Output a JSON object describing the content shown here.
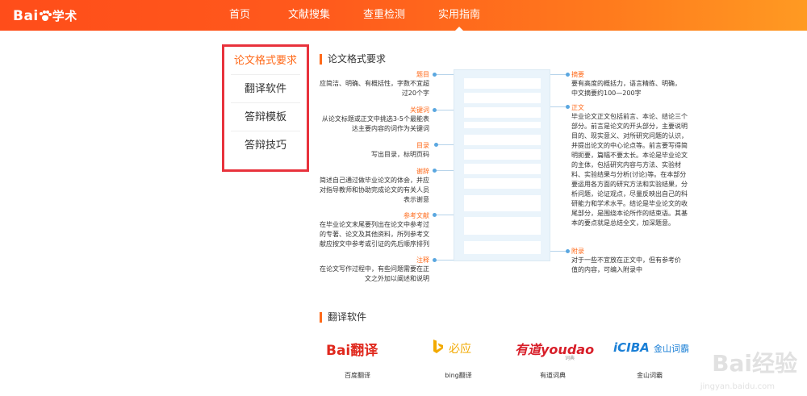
{
  "header": {
    "logo_text": "Bai",
    "logo_suffix": "学术",
    "nav": [
      "首页",
      "文献搜集",
      "查重检测",
      "实用指南"
    ]
  },
  "sidebar": {
    "items": [
      "论文格式要求",
      "翻译软件",
      "答辩模板",
      "答辩技巧"
    ]
  },
  "format": {
    "title": "论文格式要求",
    "left": [
      {
        "head": "题目",
        "body": [
          "应简洁、明确、有概括性，字数不宜超",
          "过20个字"
        ]
      },
      {
        "head": "关键词",
        "body": [
          "从论文标题或正文中挑选3-5个最能表",
          "达主要内容的词作为关键词"
        ]
      },
      {
        "head": "目录",
        "body": [
          "写出目录，标明页码"
        ]
      },
      {
        "head": "谢辞",
        "body": [
          "简述自己通过做毕业论文的体会，并应",
          "对指导教师和协助完成论文的有关人员",
          "表示谢意"
        ]
      },
      {
        "head": "参考文献",
        "body": [
          "在毕业论文末尾要列出在论文中参考过",
          "的专著、论文及其他资料，所列参考文",
          "献应按文中参考或引证的先后顺序排列"
        ]
      },
      {
        "head": "注释",
        "body": [
          "在论文写作过程中，有些问题需要在正",
          "文之外加以阐述和说明"
        ]
      }
    ],
    "right": [
      {
        "head": "摘要",
        "body": [
          "要有高度的概括力，语言精练、明确，",
          "中文摘要约100—200字"
        ]
      },
      {
        "head": "正文",
        "body": [
          "毕业论文正文包括前言、本论、结论三个",
          "部分。前言是论文的开头部分，主要说明",
          "目的、现实意义、对所研究问题的认识，",
          "并提出论文的中心论点等。前言要写得简",
          "明扼要，篇幅不要太长。本论是毕业论文",
          "的主体，包括研究内容与方法、实验材",
          "料、实验结果与分析(讨论)等。在本部分",
          "要运用各方面的研究方法和实验结果，分",
          "析问题，论证观点，尽量反映出自己的科",
          "研能力和学术水平。结论是毕业论文的收",
          "尾部分，是围绕本论所作的结束语。其基",
          "本的要点就是总结全文，加深题意。"
        ]
      },
      {
        "head": "附录",
        "body": [
          "对于一些不宜放在正文中，但有参考价",
          "值的内容，可编入附录中"
        ]
      }
    ]
  },
  "translate": {
    "title": "翻译软件",
    "items": [
      {
        "logo": "Bai翻译",
        "name": "百度翻译"
      },
      {
        "logo": "必应",
        "name": "bing翻译"
      },
      {
        "logo": "有道youdao",
        "logo_sub": "词典",
        "name": "有道词典"
      },
      {
        "logo": "iCIBA",
        "logo_sub": "金山词霸",
        "name": "金山词霸"
      }
    ]
  },
  "watermark": {
    "text": "Bai经验",
    "url": "jingyan.baidu.com"
  },
  "colors": {
    "accent": "#ff6a1a",
    "header_start": "#ff4d1a",
    "header_end": "#ff9a22",
    "highlight_box": "#e8323c",
    "connector": "#b6d3ea"
  }
}
